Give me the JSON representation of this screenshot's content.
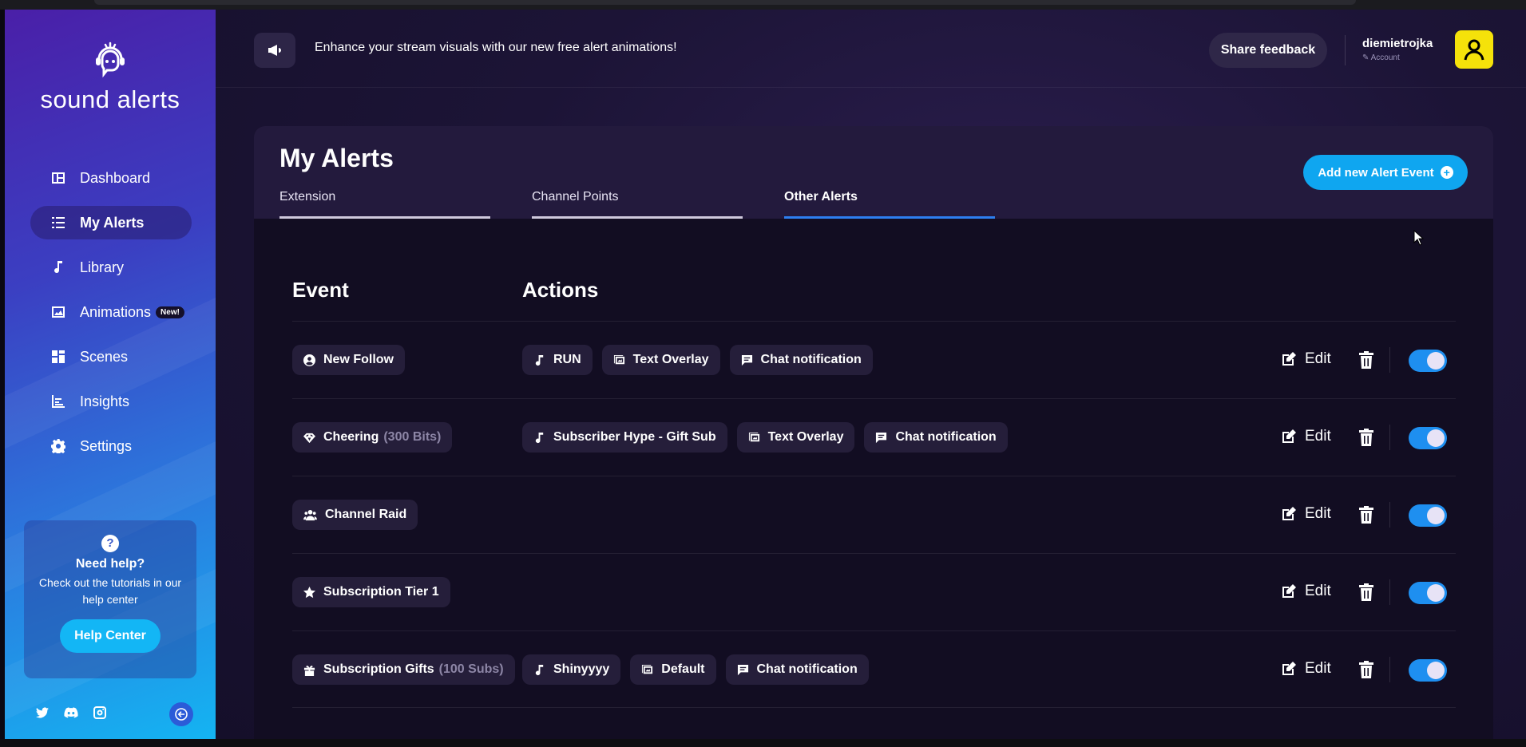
{
  "app": {
    "brand": "sound alerts"
  },
  "banner": {
    "text": "Enhance your stream visuals with our new free alert animations!",
    "share_label": "Share feedback"
  },
  "user": {
    "name": "diemietrojka",
    "account_label": "Account"
  },
  "sidebar": {
    "items": [
      {
        "label": "Dashboard",
        "icon": "dashboard-icon"
      },
      {
        "label": "My Alerts",
        "icon": "list-icon"
      },
      {
        "label": "Library",
        "icon": "music-note-icon"
      },
      {
        "label": "Animations",
        "icon": "image-icon",
        "badge": "New!"
      },
      {
        "label": "Scenes",
        "icon": "grid-icon"
      },
      {
        "label": "Insights",
        "icon": "chart-icon"
      },
      {
        "label": "Settings",
        "icon": "gear-icon"
      }
    ],
    "help": {
      "icon": "?",
      "title": "Need help?",
      "text": "Check out the tutorials in our help center",
      "button": "Help Center"
    }
  },
  "page": {
    "title": "My Alerts",
    "tabs": [
      "Extension",
      "Channel Points",
      "Other Alerts"
    ],
    "active_tab": "Other Alerts",
    "add_button": "Add new Alert Event",
    "columns": {
      "event": "Event",
      "actions": "Actions"
    }
  },
  "rows": [
    {
      "event": "New Follow",
      "event_sub": "",
      "actions": [
        "RUN",
        "Text Overlay",
        "Chat notification"
      ]
    },
    {
      "event": "Cheering",
      "event_sub": "(300 Bits)",
      "actions": [
        "Subscriber Hype - Gift Sub",
        "Text Overlay",
        "Chat notification"
      ]
    },
    {
      "event": "Channel Raid",
      "event_sub": "",
      "actions": []
    },
    {
      "event": "Subscription Tier 1",
      "event_sub": "",
      "actions": []
    },
    {
      "event": "Subscription Gifts",
      "event_sub": "(100 Subs)",
      "actions": [
        "Shinyyyy",
        "Default",
        "Chat notification"
      ]
    }
  ],
  "row_controls": {
    "edit_label": "Edit",
    "enabled": true
  },
  "colors": {
    "accent": "#0fa6f0",
    "toggle_on": "#1e8ff0",
    "avatar_bg": "#f5e20a"
  }
}
